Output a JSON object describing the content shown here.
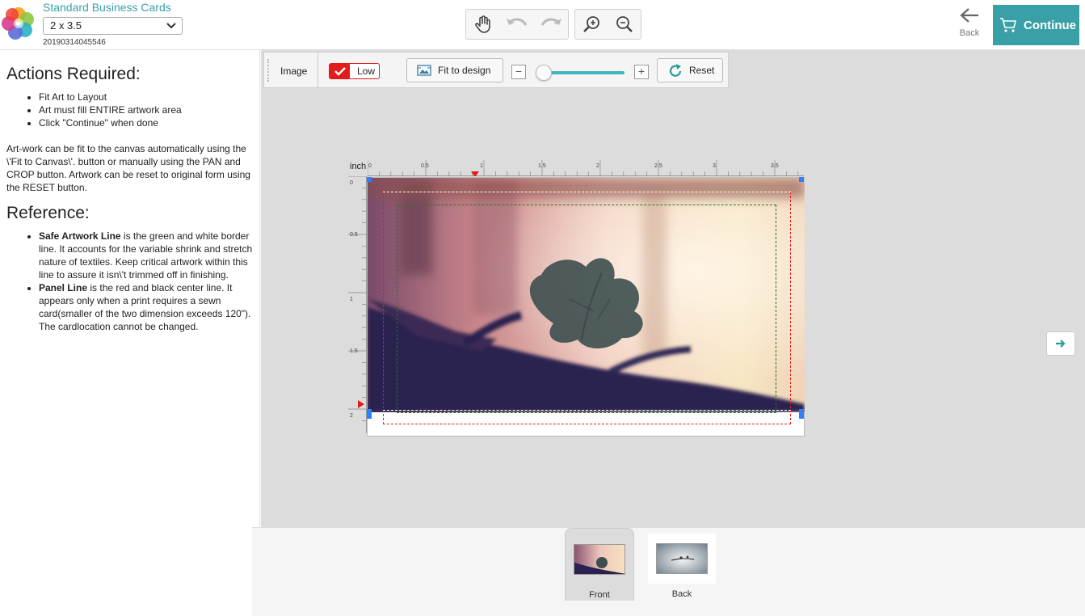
{
  "header": {
    "product_title": "Standard Business Cards",
    "size_selected": "2 x 3.5",
    "order_id": "20190314045546",
    "back_label": "Back",
    "continue_label": "Continue",
    "tools": [
      "hand-pan-icon",
      "undo-icon",
      "redo-icon",
      "zoom-in-icon",
      "zoom-out-icon"
    ]
  },
  "left_panel": {
    "actions_title": "Actions Required:",
    "actions": [
      "Fit Art to Layout",
      "Art must fill ENTIRE artwork area",
      "Click \"Continue\" when done"
    ],
    "description": "Art-work can be fit to the canvas automatically using the \\'Fit to Canvas\\'. button or manually using the PAN and CROP button. Artwork can be reset to original form using the RESET button.",
    "reference_title": "Reference:",
    "references": [
      {
        "term": "Safe Artwork Line",
        "text": " is the green and white border line. It accounts for the variable shrink and stretch nature of textiles. Keep critical artwork within this line to assure it isn\\'t trimmed off in finishing."
      },
      {
        "term": "Panel Line",
        "text": " is the red and black center line. It appears only when a print requires a sewn card(smaller of the two dimension exceeds 120\"). The cardlocation cannot be changed."
      }
    ]
  },
  "image_toolbar": {
    "label": "Image",
    "quality_label": "Low",
    "fit_label": "Fit to design",
    "reset_label": "Reset",
    "zoom_minus": "−",
    "zoom_plus": "+",
    "zoom_level": 0
  },
  "ruler": {
    "unit": "inch",
    "top_ticks": [
      "0",
      "0.5",
      "1",
      "1.5",
      "2",
      "2.5",
      "3",
      "3.5"
    ],
    "left_ticks": [
      "0",
      "0.5",
      "1",
      "1.5",
      "2"
    ]
  },
  "pages": [
    {
      "label": "Front",
      "active": true
    },
    {
      "label": "Back",
      "active": false
    }
  ],
  "colors": {
    "accent": "#3aa0a8",
    "panel_line": "#e21b1b",
    "safe_line": "#1f7a1f",
    "slider": "#44b4be",
    "handles": "#2f7fff"
  }
}
